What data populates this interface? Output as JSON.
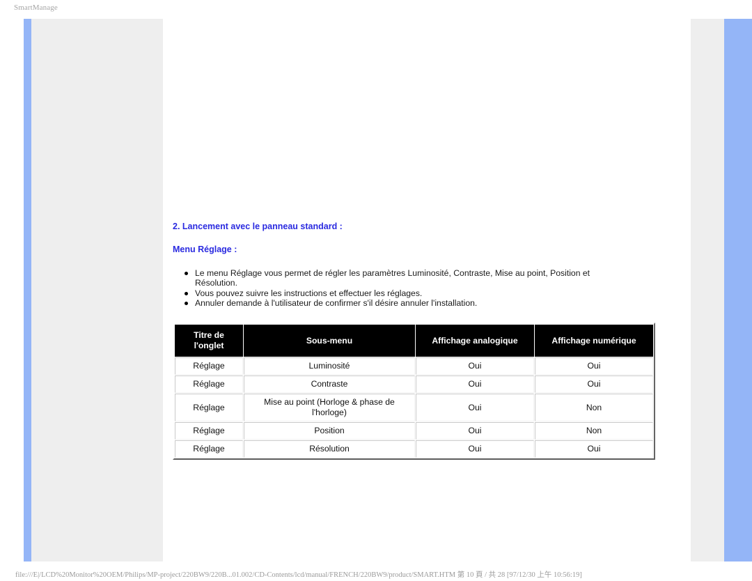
{
  "window": {
    "title": "SmartManage"
  },
  "content": {
    "heading_1": "2. Lancement avec le panneau standard :",
    "heading_2": "Menu Réglage :",
    "bullets": [
      "Le menu Réglage vous permet de régler les paramètres Luminosité, Contraste, Mise au point, Position et Résolution.",
      "Vous pouvez suivre les instructions et effectuer les réglages.",
      "Annuler demande à l'utilisateur de confirmer s'il désire annuler l'installation."
    ],
    "table": {
      "headers": [
        "Titre de l'onglet",
        "Sous-menu",
        "Affichage analogique",
        "Affichage numérique"
      ],
      "rows": [
        {
          "tab": "Réglage",
          "submenu": "Luminosité",
          "analog": "Oui",
          "digital": "Oui"
        },
        {
          "tab": "Réglage",
          "submenu": "Contraste",
          "analog": "Oui",
          "digital": "Oui"
        },
        {
          "tab": "Réglage",
          "submenu": "Mise au point (Horloge & phase de l'horloge)",
          "analog": "Oui",
          "digital": "Non"
        },
        {
          "tab": "Réglage",
          "submenu": "Position",
          "analog": "Oui",
          "digital": "Non"
        },
        {
          "tab": "Réglage",
          "submenu": "Résolution",
          "analog": "Oui",
          "digital": "Oui"
        }
      ]
    }
  },
  "status_bar": {
    "text": "file:///E|/LCD%20Monitor%20OEM/Philips/MP-project/220BW9/220B...01.002/CD-Contents/lcd/manual/FRENCH/220BW9/product/SMART.HTM 第 10 頁 / 共 28 [97/12/30 上午 10:56:19]"
  },
  "theme": {
    "accent_blue": "#94b5f7",
    "panel_gray": "#eeeeee",
    "heading_color": "#2a2ae0",
    "header_bg": "#000000"
  }
}
